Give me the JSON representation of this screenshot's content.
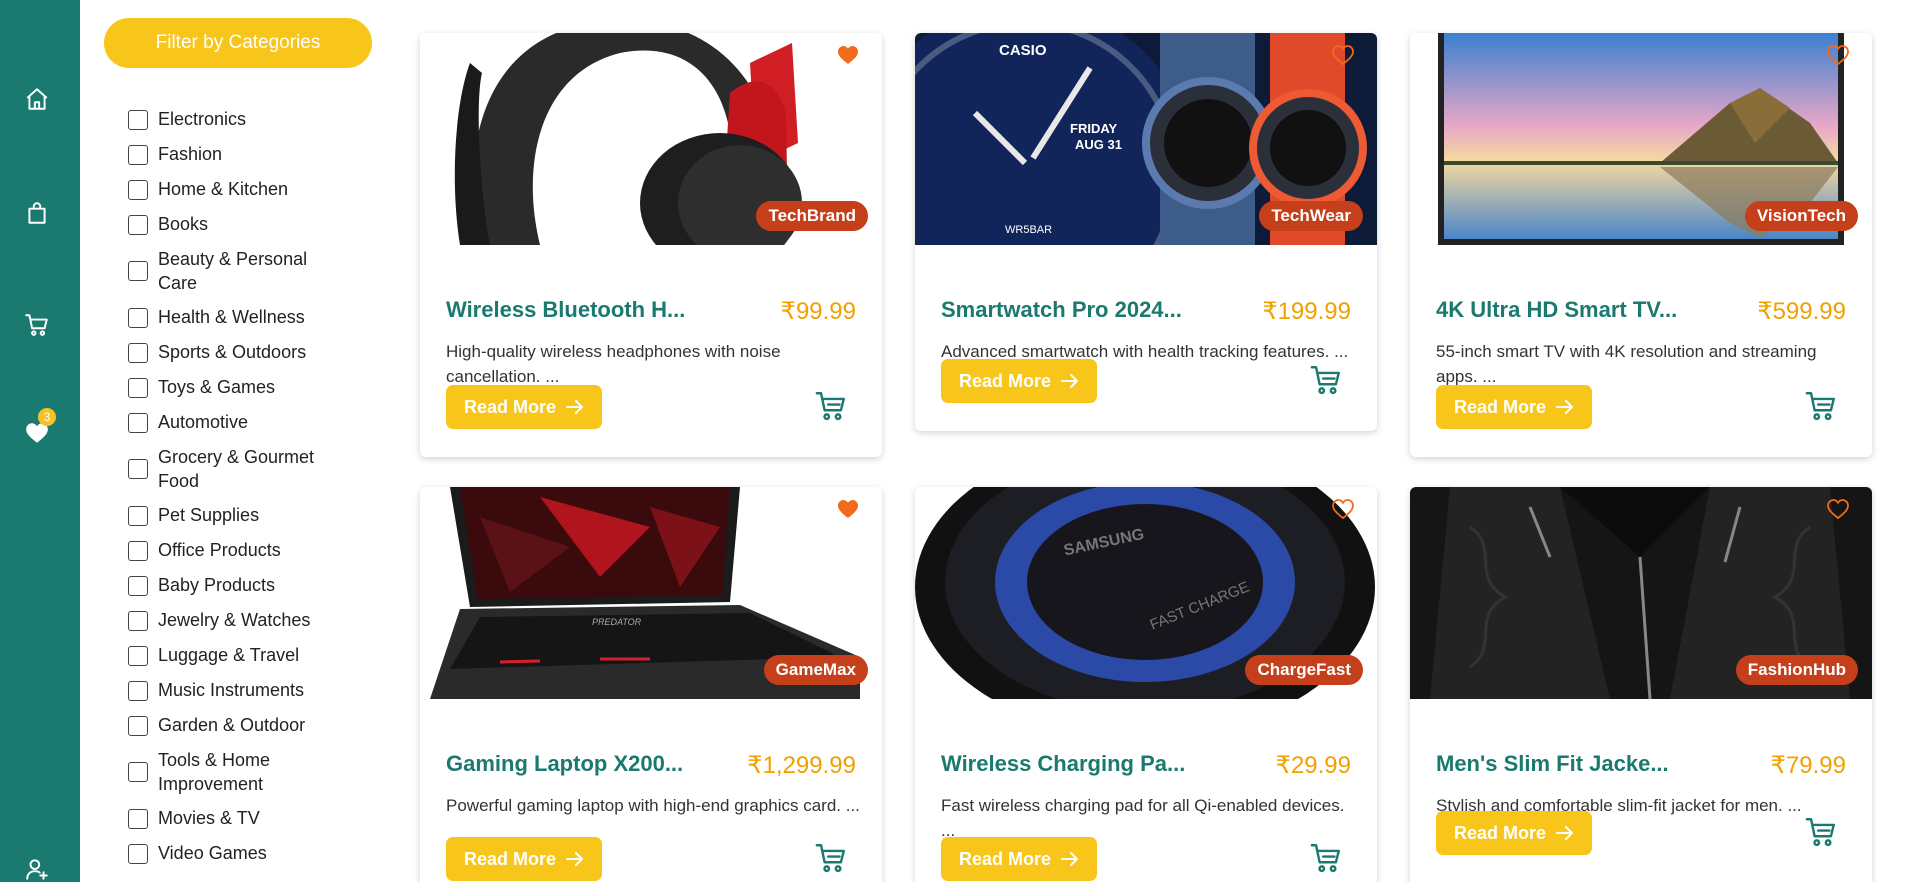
{
  "rail": {
    "wishlist_count": "3"
  },
  "sidebar": {
    "filter_label": "Filter by Categories",
    "categories": [
      "Electronics",
      "Fashion",
      "Home & Kitchen",
      "Books",
      "Beauty & Personal Care",
      "Health & Wellness",
      "Sports & Outdoors",
      "Toys & Games",
      "Automotive",
      "Grocery & Gourmet Food",
      "Pet Supplies",
      "Office Products",
      "Baby Products",
      "Jewelry & Watches",
      "Luggage & Travel",
      "Music Instruments",
      "Garden & Outdoor",
      "Tools & Home Improvement",
      "Movies & TV",
      "Video Games"
    ]
  },
  "products": [
    {
      "title": "Wireless Bluetooth H...",
      "price": "₹99.99",
      "brand": "TechBrand",
      "description": "High-quality wireless headphones with noise cancellation. ...",
      "read_more": "Read More",
      "favorited": true
    },
    {
      "title": "Smartwatch Pro 2024...",
      "price": "₹199.99",
      "brand": "TechWear",
      "description": "Advanced smartwatch with health tracking features. ...",
      "read_more": "Read More",
      "favorited": false,
      "image_text": {
        "logo": "CASIO",
        "day": "FRIDAY",
        "date": "AUG 31",
        "model": "WR5BAR"
      }
    },
    {
      "title": "4K Ultra HD Smart TV...",
      "price": "₹599.99",
      "brand": "VisionTech",
      "description": "55-inch smart TV with 4K resolution and streaming apps. ...",
      "read_more": "Read More",
      "favorited": false
    },
    {
      "title": "Gaming Laptop X200...",
      "price": "₹1,299.99",
      "brand": "GameMax",
      "description": "Powerful gaming laptop with high-end graphics card. ...",
      "read_more": "Read More",
      "favorited": true,
      "image_text": {
        "logo": "PREDATOR"
      }
    },
    {
      "title": "Wireless Charging Pa...",
      "price": "₹29.99",
      "brand": "ChargeFast",
      "description": "Fast wireless charging pad for all Qi-enabled devices. ...",
      "read_more": "Read More",
      "favorited": false,
      "image_text": {
        "logo": "SAMSUNG",
        "caption": "FAST CHARGE"
      }
    },
    {
      "title": "Men's Slim Fit Jacke...",
      "price": "₹79.99",
      "brand": "FashionHub",
      "description": "Stylish and comfortable slim-fit jacket for men. ...",
      "read_more": "Read More",
      "favorited": false
    }
  ],
  "colors": {
    "rail": "#1a7a6f",
    "accent": "#f8c61a",
    "title": "#1a7a6f",
    "price": "#f0a100",
    "brand_badge": "#c5401a",
    "heart": "#f26a1b"
  },
  "icons": {
    "rail": [
      "home-icon",
      "shopping-bag-icon",
      "cart-icon",
      "heart-icon",
      "add-user-icon"
    ],
    "card": [
      "heart-icon",
      "arrow-right-icon",
      "cart-icon"
    ]
  }
}
